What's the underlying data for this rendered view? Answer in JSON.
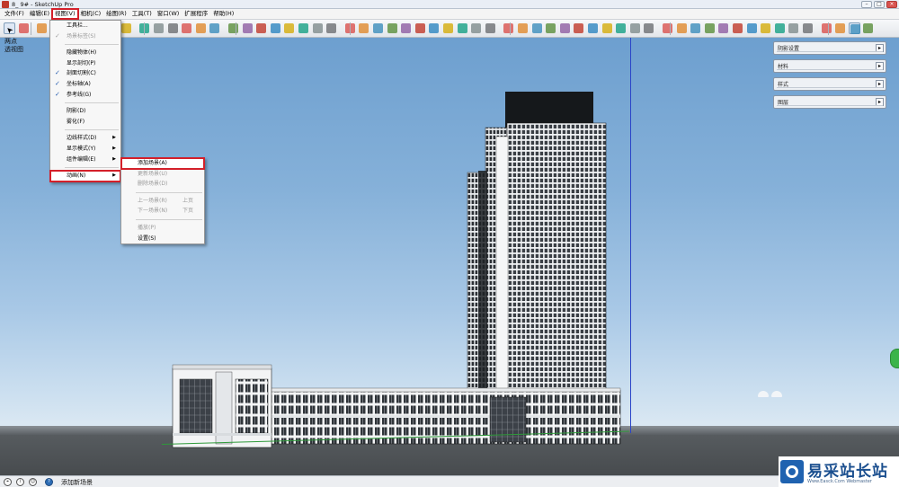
{
  "window": {
    "title": "8_ 9# - SketchUp Pro",
    "min": "–",
    "max": "□",
    "close": "×"
  },
  "menubar": [
    {
      "label": "文件(F)"
    },
    {
      "label": "编辑(E)"
    },
    {
      "label": "视图(V)"
    },
    {
      "label": "相机(C)"
    },
    {
      "label": "绘图(R)"
    },
    {
      "label": "工具(T)"
    },
    {
      "label": "窗口(W)"
    },
    {
      "label": "扩展程序"
    },
    {
      "label": "帮助(H)"
    }
  ],
  "toolbar_icons": [
    "select-tool-icon",
    "eraser-tool-icon",
    "pencil-tool-icon",
    "orbit-tool-icon",
    "pan-tool-icon",
    "zoom-tool-icon",
    "walk-tool-icon",
    "tape-measure-icon",
    "text-tool-icon",
    "paint-bucket-icon",
    "move-tool-icon",
    "rotate-tool-icon",
    "scale-tool-icon",
    "offset-tool-icon",
    "push-pull-icon",
    "section-plane-icon",
    "layers-icon",
    "component-icon",
    "style-icon",
    "shadow-icon",
    "extension-icon"
  ],
  "scene_label": {
    "line1": "两点",
    "line2": "透视图"
  },
  "view_menu": [
    {
      "label": "工具栏...",
      "type": "item"
    },
    {
      "label": "场景标签(S)",
      "type": "item",
      "checked": true,
      "disabled": true
    },
    {
      "type": "divider"
    },
    {
      "label": "隐藏物体(H)",
      "type": "item"
    },
    {
      "label": "显示剖切(P)",
      "type": "item"
    },
    {
      "label": "剖面切割(C)",
      "type": "item",
      "checked": true
    },
    {
      "label": "坐标轴(A)",
      "type": "item",
      "checked": true
    },
    {
      "label": "参考线(G)",
      "type": "item",
      "checked": true
    },
    {
      "type": "divider"
    },
    {
      "label": "阴影(D)",
      "type": "item"
    },
    {
      "label": "雾化(F)",
      "type": "item"
    },
    {
      "type": "divider"
    },
    {
      "label": "边线样式(D)",
      "type": "item",
      "submenu": true
    },
    {
      "label": "显示模式(Y)",
      "type": "item",
      "submenu": true
    },
    {
      "label": "组件编辑(E)",
      "type": "item",
      "submenu": true
    },
    {
      "type": "divider"
    },
    {
      "label": "动画(N)",
      "type": "item",
      "submenu": true,
      "highlighted": true
    }
  ],
  "animation_menu": [
    {
      "label": "添加场景(A)",
      "type": "item",
      "highlighted": true
    },
    {
      "label": "更新场景(U)",
      "type": "item",
      "disabled": true
    },
    {
      "label": "删除场景(D)",
      "type": "item",
      "disabled": true
    },
    {
      "type": "divider"
    },
    {
      "label": "上一场景(R)",
      "shortcut": "上页",
      "type": "item",
      "disabled": true
    },
    {
      "label": "下一场景(N)",
      "shortcut": "下页",
      "type": "item",
      "disabled": true
    },
    {
      "type": "divider"
    },
    {
      "label": "播放(P)",
      "type": "item",
      "disabled": true
    },
    {
      "label": "设置(S)",
      "type": "item"
    }
  ],
  "trays": [
    {
      "label": "阴影设置"
    },
    {
      "label": "材料"
    },
    {
      "label": "样式"
    },
    {
      "label": "图层"
    }
  ],
  "status": {
    "text": "添加新场景"
  },
  "watermark": {
    "title": "易采站长站",
    "subtitle": "Www.Easck.Com Webmaster"
  },
  "colors": {
    "highlight_red": "#d4202a",
    "sky_top": "#6d9fcf",
    "ground": "#4e5356"
  }
}
